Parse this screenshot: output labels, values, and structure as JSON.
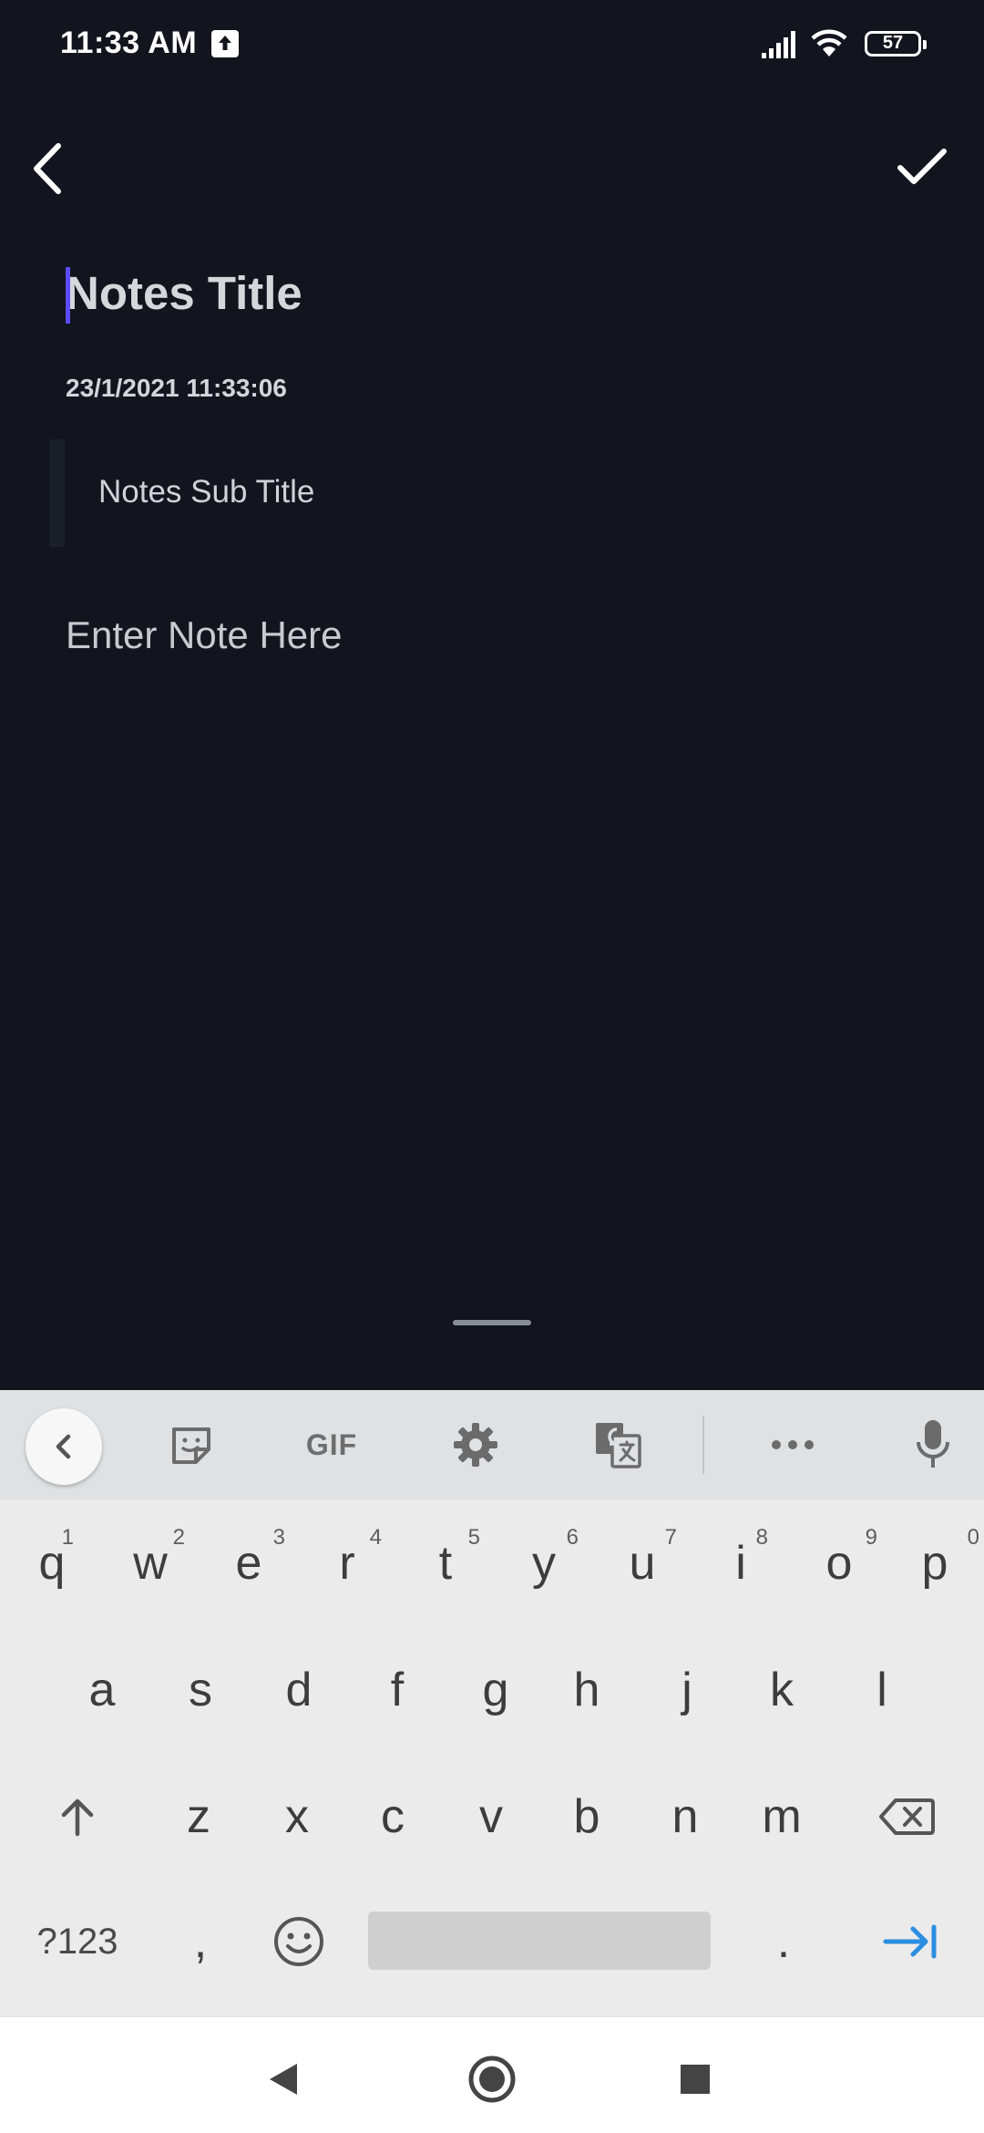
{
  "status_bar": {
    "time": "11:33 AM",
    "battery": "57"
  },
  "editor": {
    "title_placeholder": "Notes Title",
    "date_time": "23/1/2021 11:33:06",
    "subtitle_placeholder": "Notes Sub Title",
    "note_placeholder": "Enter Note Here"
  },
  "keyboard": {
    "toolbar": {
      "gif_label": "GIF"
    },
    "row1": [
      {
        "key": "q",
        "hint": "1"
      },
      {
        "key": "w",
        "hint": "2"
      },
      {
        "key": "e",
        "hint": "3"
      },
      {
        "key": "r",
        "hint": "4"
      },
      {
        "key": "t",
        "hint": "5"
      },
      {
        "key": "y",
        "hint": "6"
      },
      {
        "key": "u",
        "hint": "7"
      },
      {
        "key": "i",
        "hint": "8"
      },
      {
        "key": "o",
        "hint": "9"
      },
      {
        "key": "p",
        "hint": "0"
      }
    ],
    "row2": [
      "a",
      "s",
      "d",
      "f",
      "g",
      "h",
      "j",
      "k",
      "l"
    ],
    "row3": [
      "z",
      "x",
      "c",
      "v",
      "b",
      "n",
      "m"
    ],
    "row4": {
      "symbols_label": "?123",
      "comma": ",",
      "period": "."
    },
    "accent_color": "#2b8ee0"
  },
  "icons": {
    "back": "chevron-left-icon",
    "save": "checkmark-icon",
    "sticker": "sticker-icon",
    "settings": "gear-icon",
    "translate": "translate-icon",
    "more": "more-horizontal-icon",
    "voice": "microphone-icon",
    "shift": "shift-arrow-icon",
    "delete": "backspace-icon",
    "emoji": "emoji-icon",
    "enter": "tab-arrow-icon"
  },
  "theme": {
    "background": "#12151d",
    "caret": "#5b4bff"
  }
}
